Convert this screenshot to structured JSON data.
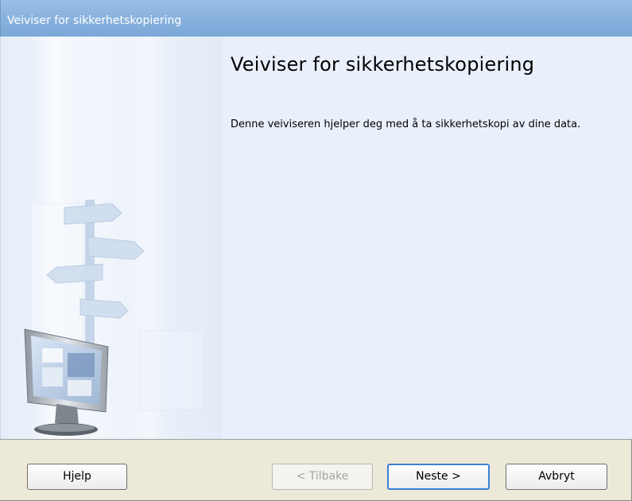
{
  "window": {
    "title": "Veiviser for sikkerhetskopiering"
  },
  "page": {
    "heading": "Veiviser for sikkerhetskopiering",
    "description": "Denne veiviseren hjelper deg med å ta sikkerhetskopi av dine data."
  },
  "buttons": {
    "help": "Hjelp",
    "back": "< Tilbake",
    "next": "Neste >",
    "cancel": "Avbryt"
  },
  "colors": {
    "titlebar": "#8ab3de",
    "content_bg": "#e9f0fc",
    "default_button_border": "#3c7fd9"
  },
  "icons": [
    "signpost-illustration",
    "computer-monitor-illustration"
  ]
}
